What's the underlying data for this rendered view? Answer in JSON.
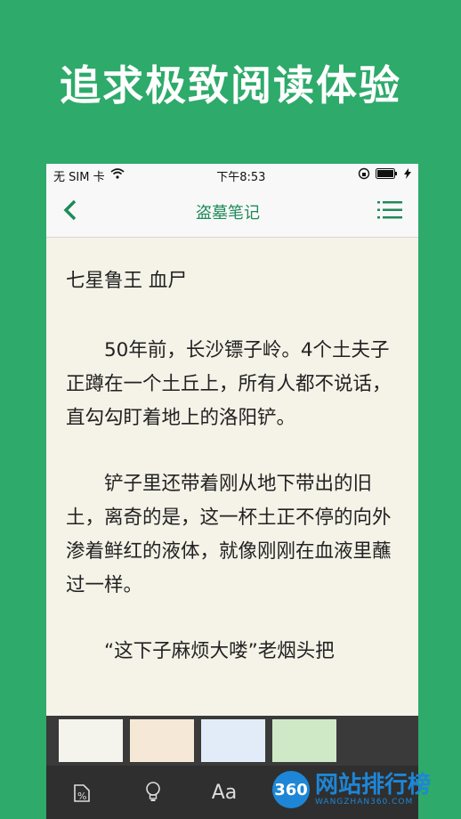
{
  "headline": "追求极致阅读体验",
  "status": {
    "carrier": "无 SIM 卡",
    "time": "下午8:53"
  },
  "nav": {
    "title": "盗墓笔记"
  },
  "reader": {
    "chapter": "七星鲁王 血尸",
    "paragraphs": [
      "50年前，长沙镖子岭。4个土夫子正蹲在一个土丘上，所有人都不说话，直勾勾盯着地上的洛阳铲。",
      "铲子里还带着刚从地下带出的旧土，离奇的是，这一杯土正不停的向外渗着鲜红的液体，就像刚刚在血液里蘸过一样。",
      "“这下子麻烦大喽”老烟头把"
    ]
  },
  "themes": [
    "#f4f3ec",
    "#f5e8d6",
    "#e2ecf8",
    "#cfe9c6",
    "#3a3a3a"
  ],
  "toolbar": {
    "font_label": "Aa"
  },
  "watermark": {
    "badge": "360",
    "name": "网站排行榜",
    "url": "WANGZHAN360.COM"
  }
}
